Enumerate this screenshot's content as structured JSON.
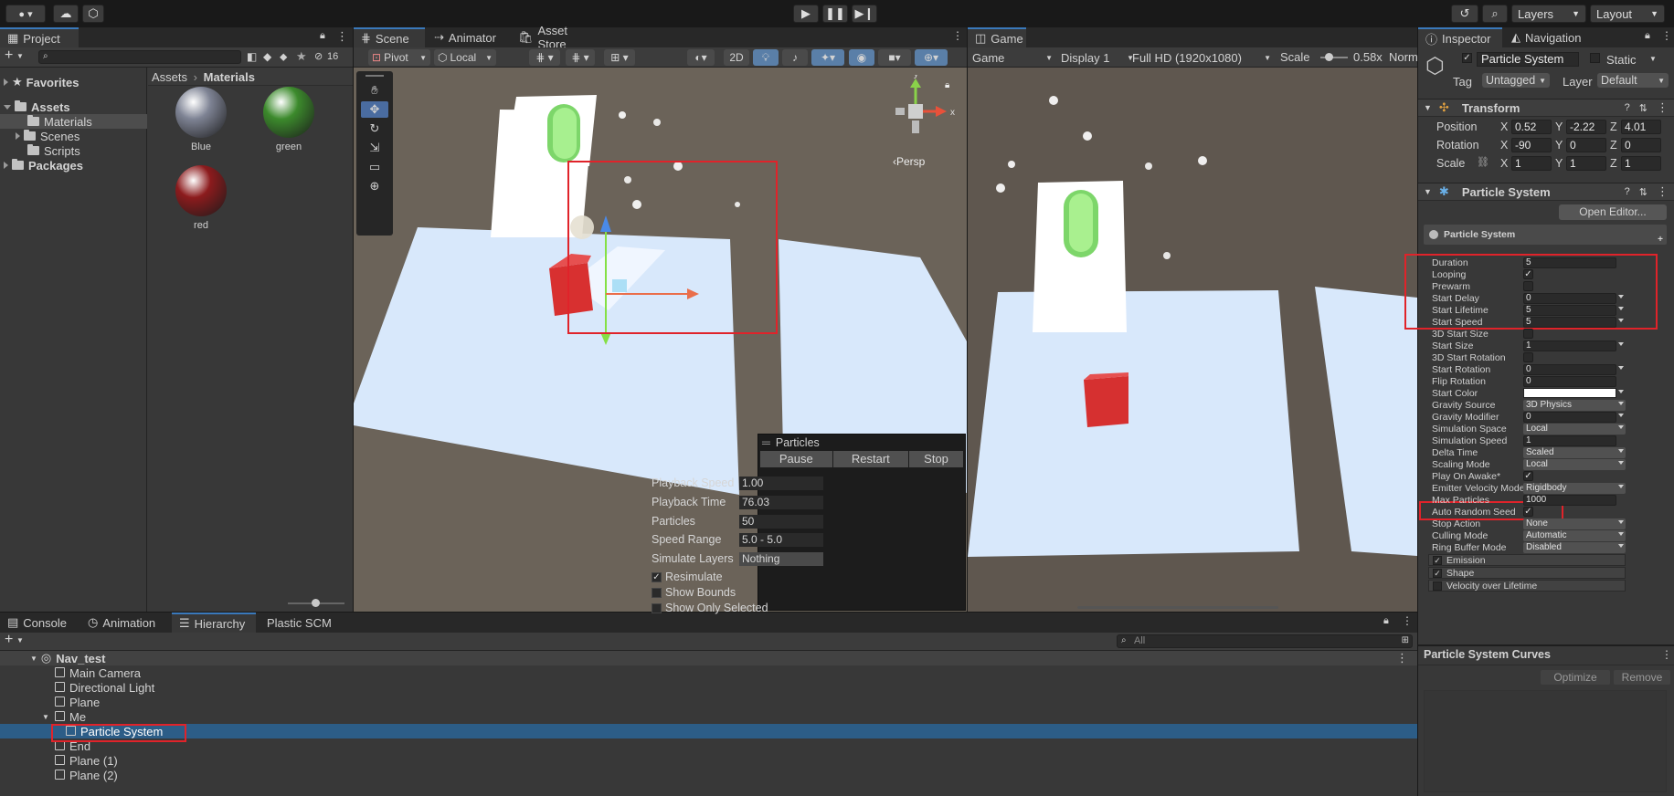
{
  "toolbar": {
    "layers_label": "Layers",
    "layout_label": "Layout"
  },
  "project": {
    "tab": "Project",
    "count": "16",
    "favorites": "Favorites",
    "assets": "Assets",
    "tree": [
      "Materials",
      "Scenes",
      "Scripts"
    ],
    "packages": "Packages",
    "breadcrumb_root": "Assets",
    "breadcrumb_current": "Materials",
    "materials": [
      {
        "name": "Blue",
        "color": "#7e8394"
      },
      {
        "name": "green",
        "color": "#3c8a2c"
      },
      {
        "name": "red",
        "color": "#8c1b1d"
      }
    ]
  },
  "scene": {
    "tabs": [
      "Scene",
      "Animator",
      "Asset Store"
    ],
    "pivot": "Pivot",
    "local": "Local",
    "mode_2d": "2D",
    "persp": "Persp"
  },
  "particles": {
    "title": "Particles",
    "buttons": [
      "Pause",
      "Restart",
      "Stop"
    ],
    "rows": [
      {
        "label": "Playback Speed",
        "value": "1.00"
      },
      {
        "label": "Playback Time",
        "value": "76.03"
      },
      {
        "label": "Particles",
        "value": "50"
      },
      {
        "label": "Speed Range",
        "value": "5.0 - 5.0"
      },
      {
        "label": "Simulate Layers",
        "value": "Nothing"
      }
    ],
    "checks": [
      {
        "label": "Resimulate",
        "checked": true
      },
      {
        "label": "Show Bounds",
        "checked": false
      },
      {
        "label": "Show Only Selected",
        "checked": false
      }
    ]
  },
  "game": {
    "tab": "Game",
    "mode": "Game",
    "display": "Display 1",
    "resolution": "Full HD (1920x1080)",
    "scale_label": "Scale",
    "scale_value": "0.58x",
    "norm": "Norm"
  },
  "inspector": {
    "tabs": [
      "Inspector",
      "Navigation"
    ],
    "object_name": "Particle System",
    "static_label": "Static",
    "tag_label": "Tag",
    "tag_value": "Untagged",
    "layer_label": "Layer",
    "layer_value": "Default",
    "transform": {
      "title": "Transform",
      "position": {
        "label": "Position",
        "x": "0.52",
        "y": "-2.22",
        "z": "4.01"
      },
      "rotation": {
        "label": "Rotation",
        "x": "-90",
        "y": "0",
        "z": "0"
      },
      "scale": {
        "label": "Scale",
        "x": "1",
        "y": "1",
        "z": "1"
      }
    },
    "ps_component": "Particle System",
    "open_editor": "Open Editor...",
    "ps_header": "Particle System",
    "props": [
      {
        "k": "Duration",
        "v": "5",
        "t": "field"
      },
      {
        "k": "Looping",
        "v": "✓",
        "t": "check"
      },
      {
        "k": "Prewarm",
        "v": "",
        "t": "check"
      },
      {
        "k": "Start Delay",
        "v": "0",
        "t": "field"
      },
      {
        "k": "Start Lifetime",
        "v": "5",
        "t": "field"
      },
      {
        "k": "Start Speed",
        "v": "5",
        "t": "field"
      },
      {
        "k": "3D Start Size",
        "v": "",
        "t": "check"
      },
      {
        "k": "Start Size",
        "v": "1",
        "t": "field"
      },
      {
        "k": "3D Start Rotation",
        "v": "",
        "t": "check"
      },
      {
        "k": "Start Rotation",
        "v": "0",
        "t": "field"
      },
      {
        "k": "Flip Rotation",
        "v": "0",
        "t": "field"
      },
      {
        "k": "Start Color",
        "v": "",
        "t": "color"
      },
      {
        "k": "Gravity Source",
        "v": "3D Physics",
        "t": "dd"
      },
      {
        "k": "Gravity Modifier",
        "v": "0",
        "t": "field"
      },
      {
        "k": "Simulation Space",
        "v": "Local",
        "t": "dd"
      },
      {
        "k": "Simulation Speed",
        "v": "1",
        "t": "field"
      },
      {
        "k": "Delta Time",
        "v": "Scaled",
        "t": "dd"
      },
      {
        "k": "Scaling Mode",
        "v": "Local",
        "t": "dd"
      },
      {
        "k": "Play On Awake*",
        "v": "✓",
        "t": "check"
      },
      {
        "k": "Emitter Velocity Mode",
        "v": "Rigidbody",
        "t": "dd"
      },
      {
        "k": "Max Particles",
        "v": "1000",
        "t": "field"
      },
      {
        "k": "Auto Random Seed",
        "v": "✓",
        "t": "check"
      },
      {
        "k": "Stop Action",
        "v": "None",
        "t": "dd"
      },
      {
        "k": "Culling Mode",
        "v": "Automatic",
        "t": "dd"
      },
      {
        "k": "Ring Buffer Mode",
        "v": "Disabled",
        "t": "dd"
      }
    ],
    "modules": [
      {
        "label": "Emission",
        "checked": true
      },
      {
        "label": "Shape",
        "checked": true
      },
      {
        "label": "Velocity over Lifetime",
        "checked": false
      }
    ],
    "curves_title": "Particle System Curves",
    "optimize": "Optimize",
    "remove": "Remove"
  },
  "bottom": {
    "tabs": [
      "Console",
      "Animation",
      "Hierarchy",
      "Plastic SCM"
    ],
    "search_placeholder": "All",
    "scene_name": "Nav_test",
    "items": [
      {
        "label": "Main Camera",
        "depth": 1,
        "selected": false
      },
      {
        "label": "Directional Light",
        "depth": 1,
        "selected": false
      },
      {
        "label": "Plane",
        "depth": 1,
        "selected": false
      },
      {
        "label": "Me",
        "depth": 1,
        "selected": false
      },
      {
        "label": "Particle System",
        "depth": 2,
        "selected": true
      },
      {
        "label": "End",
        "depth": 1,
        "selected": false
      },
      {
        "label": "Plane (1)",
        "depth": 1,
        "selected": false
      },
      {
        "label": "Plane (2)",
        "depth": 1,
        "selected": false
      }
    ]
  }
}
